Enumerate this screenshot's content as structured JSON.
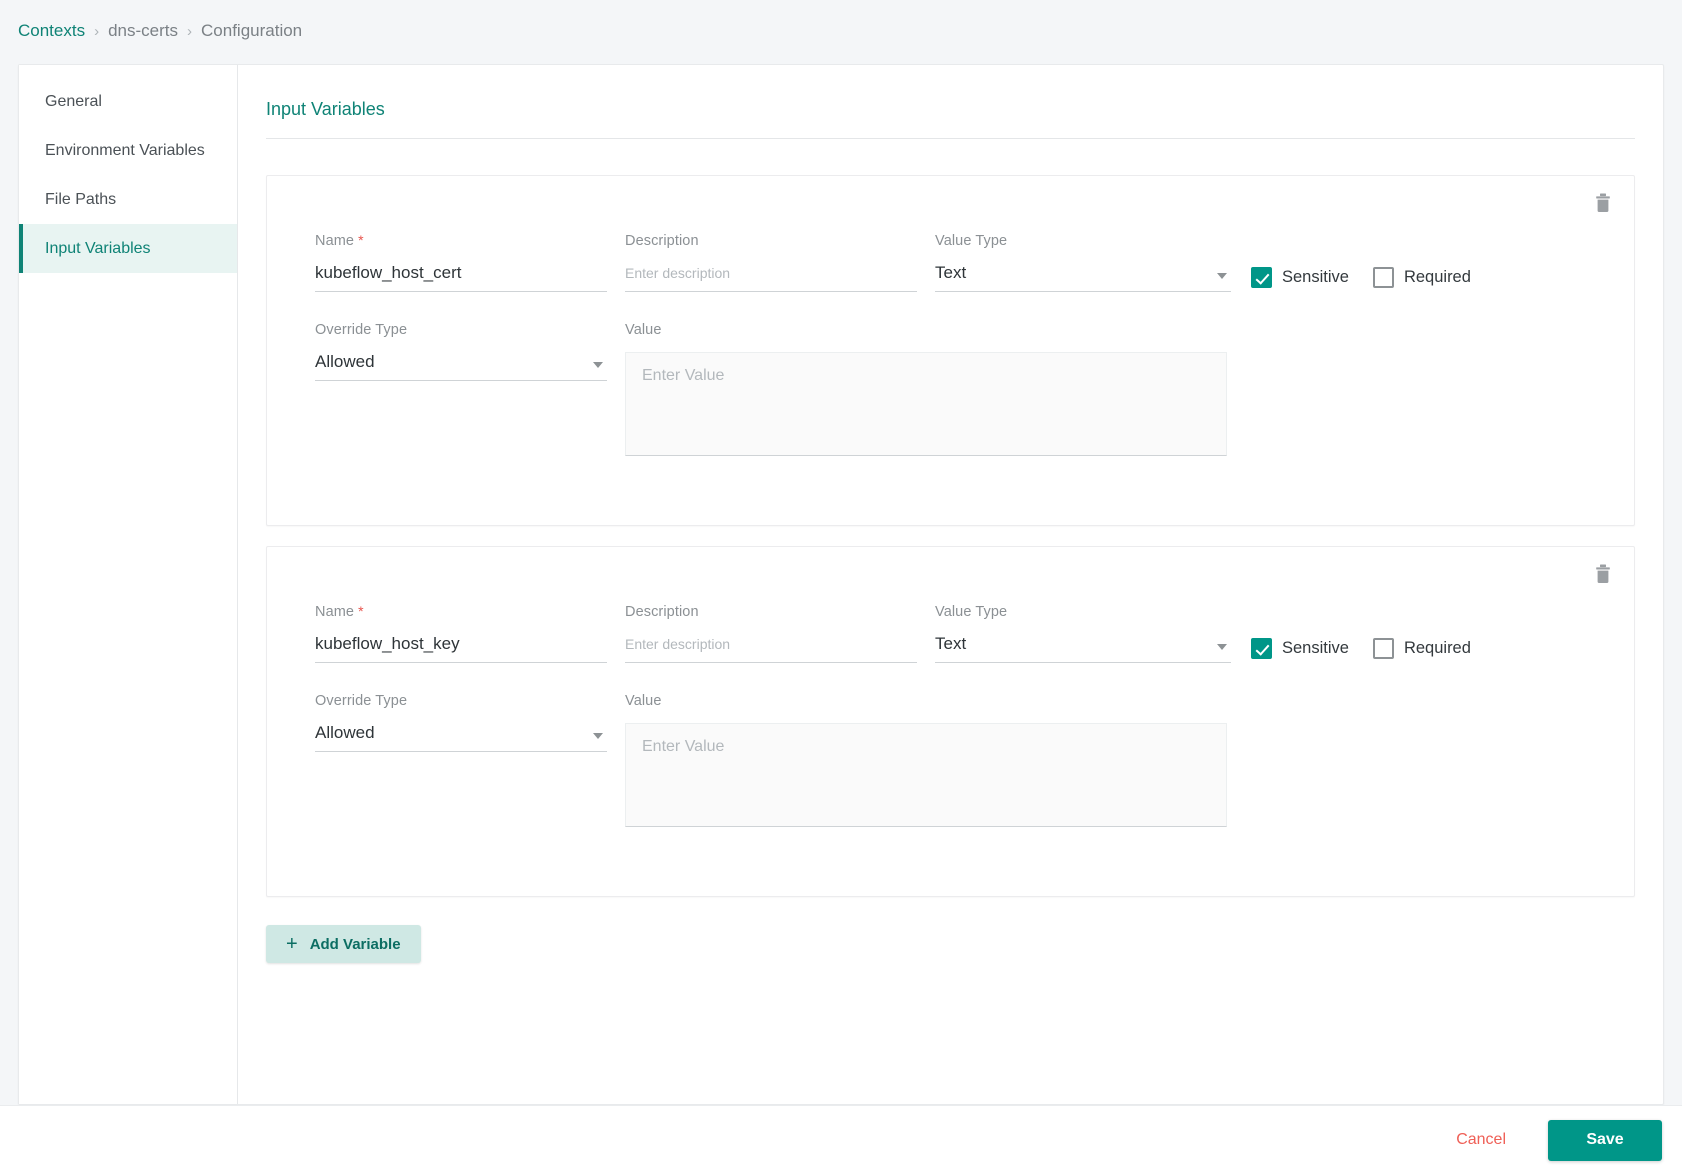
{
  "breadcrumb": {
    "items": [
      {
        "label": "Contexts",
        "type": "link"
      },
      {
        "label": "dns-certs",
        "type": "plain"
      },
      {
        "label": "Configuration",
        "type": "plain"
      }
    ],
    "separator": "›"
  },
  "sidebar": {
    "items": [
      {
        "label": "General",
        "active": false
      },
      {
        "label": "Environment Variables",
        "active": false
      },
      {
        "label": "File Paths",
        "active": false
      },
      {
        "label": "Input Variables",
        "active": true
      }
    ]
  },
  "main": {
    "title": "Input Variables",
    "add_variable_label": "Add Variable",
    "add_variable_icon": "plus-icon",
    "delete_icon": "trash-icon"
  },
  "labels": {
    "name": "Name",
    "required_marker": "*",
    "description": "Description",
    "value_type": "Value Type",
    "override_type": "Override Type",
    "value": "Value",
    "sensitive": "Sensitive",
    "required": "Required"
  },
  "placeholders": {
    "description": "Enter description",
    "value": "Enter Value"
  },
  "variables": [
    {
      "name": "kubeflow_host_cert",
      "description": "",
      "value_type": "Text",
      "override_type": "Allowed",
      "value": "",
      "sensitive": true,
      "required": false
    },
    {
      "name": "kubeflow_host_key",
      "description": "",
      "value_type": "Text",
      "override_type": "Allowed",
      "value": "",
      "sensitive": true,
      "required": false
    }
  ],
  "footer": {
    "cancel_label": "Cancel",
    "save_label": "Save"
  },
  "colors": {
    "accent_teal": "#009688",
    "link_teal": "#0f8376",
    "danger_red": "#ef5f56",
    "required_star": "#e8544d",
    "add_button_bg": "#cfe8e4",
    "sidebar_active_bg": "#e8f4f2"
  }
}
